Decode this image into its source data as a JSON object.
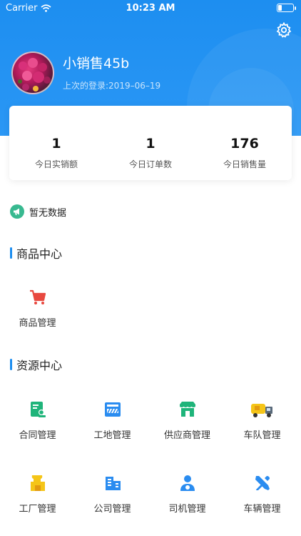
{
  "status": {
    "carrier": "Carrier",
    "time": "10:23 AM"
  },
  "profile": {
    "name": "小销售45b",
    "last_login": "上次的登录:2019–06–19"
  },
  "stats": [
    {
      "value": "1",
      "label": "今日实销额"
    },
    {
      "value": "1",
      "label": "今日订单数"
    },
    {
      "value": "176",
      "label": "今日销售量"
    }
  ],
  "notice": {
    "text": "暂无数据"
  },
  "sections": {
    "goods": {
      "title": "商品中心",
      "items": [
        {
          "label": "商品管理",
          "icon": "shopping-cart-icon"
        }
      ]
    },
    "resources": {
      "title": "资源中心",
      "items": [
        {
          "label": "合同管理",
          "icon": "contract-icon"
        },
        {
          "label": "工地管理",
          "icon": "construction-site-icon"
        },
        {
          "label": "供应商管理",
          "icon": "supplier-store-icon"
        },
        {
          "label": "车队管理",
          "icon": "fleet-truck-icon"
        },
        {
          "label": "工厂管理",
          "icon": "factory-icon"
        },
        {
          "label": "公司管理",
          "icon": "company-building-icon"
        },
        {
          "label": "司机管理",
          "icon": "driver-icon"
        },
        {
          "label": "车辆管理",
          "icon": "vehicle-tools-icon"
        }
      ]
    }
  },
  "colors": {
    "primary": "#1d8ef0",
    "accent_green": "#38b990",
    "cart_red": "#e8483f",
    "truck_yellow": "#f5c518"
  }
}
